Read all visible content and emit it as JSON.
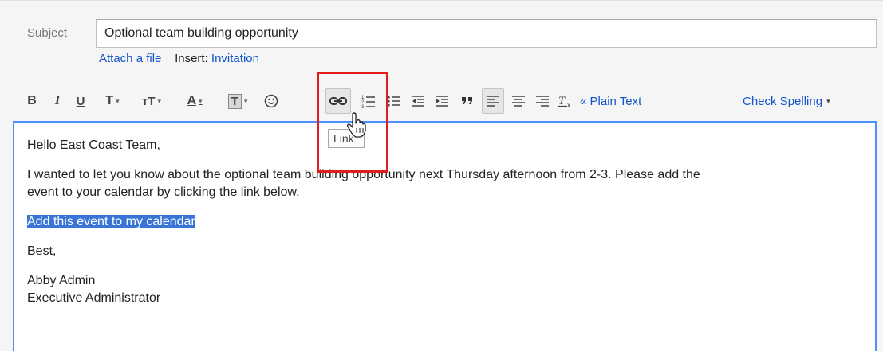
{
  "subject": {
    "label": "Subject",
    "value": "Optional team building opportunity"
  },
  "attach": {
    "attach_file": "Attach a file",
    "insert_label": "Insert:",
    "invitation": "Invitation"
  },
  "toolbar": {
    "bold": "B",
    "italic": "I",
    "underline": "U",
    "font_family": "T",
    "font_size": "тT",
    "text_color": "A",
    "highlight_color": "T",
    "caret": "▾",
    "plain_text": "« Plain Text",
    "check_spelling": "Check Spelling",
    "icons": [
      "bold-icon",
      "italic-icon",
      "underline-icon",
      "font-icon",
      "font-size-icon",
      "text-color-icon",
      "background-color-icon",
      "emoji-icon",
      "link-icon",
      "numbered-list-icon",
      "bulleted-list-icon",
      "indent-less-icon",
      "indent-more-icon",
      "quote-icon",
      "align-left-icon",
      "align-center-icon",
      "align-right-icon",
      "remove-formatting-icon"
    ]
  },
  "tooltip": {
    "text": "Link"
  },
  "editor": {
    "greeting": "Hello East Coast Team,",
    "body_line1": "I wanted to let you know about the optional team building opportunity next Thursday afternoon from 2-3. Please add the",
    "body_line2": "event to your calendar by clicking the link below.",
    "selected_link_text": "Add this event to my calendar",
    "closing": "Best,",
    "signature_name": "Abby Admin",
    "signature_title": "Executive Administrator"
  },
  "colors": {
    "link": "#1155cc",
    "selection": "#3875d7",
    "editor_border": "#4d90fe",
    "callout": "#e21b1b"
  }
}
